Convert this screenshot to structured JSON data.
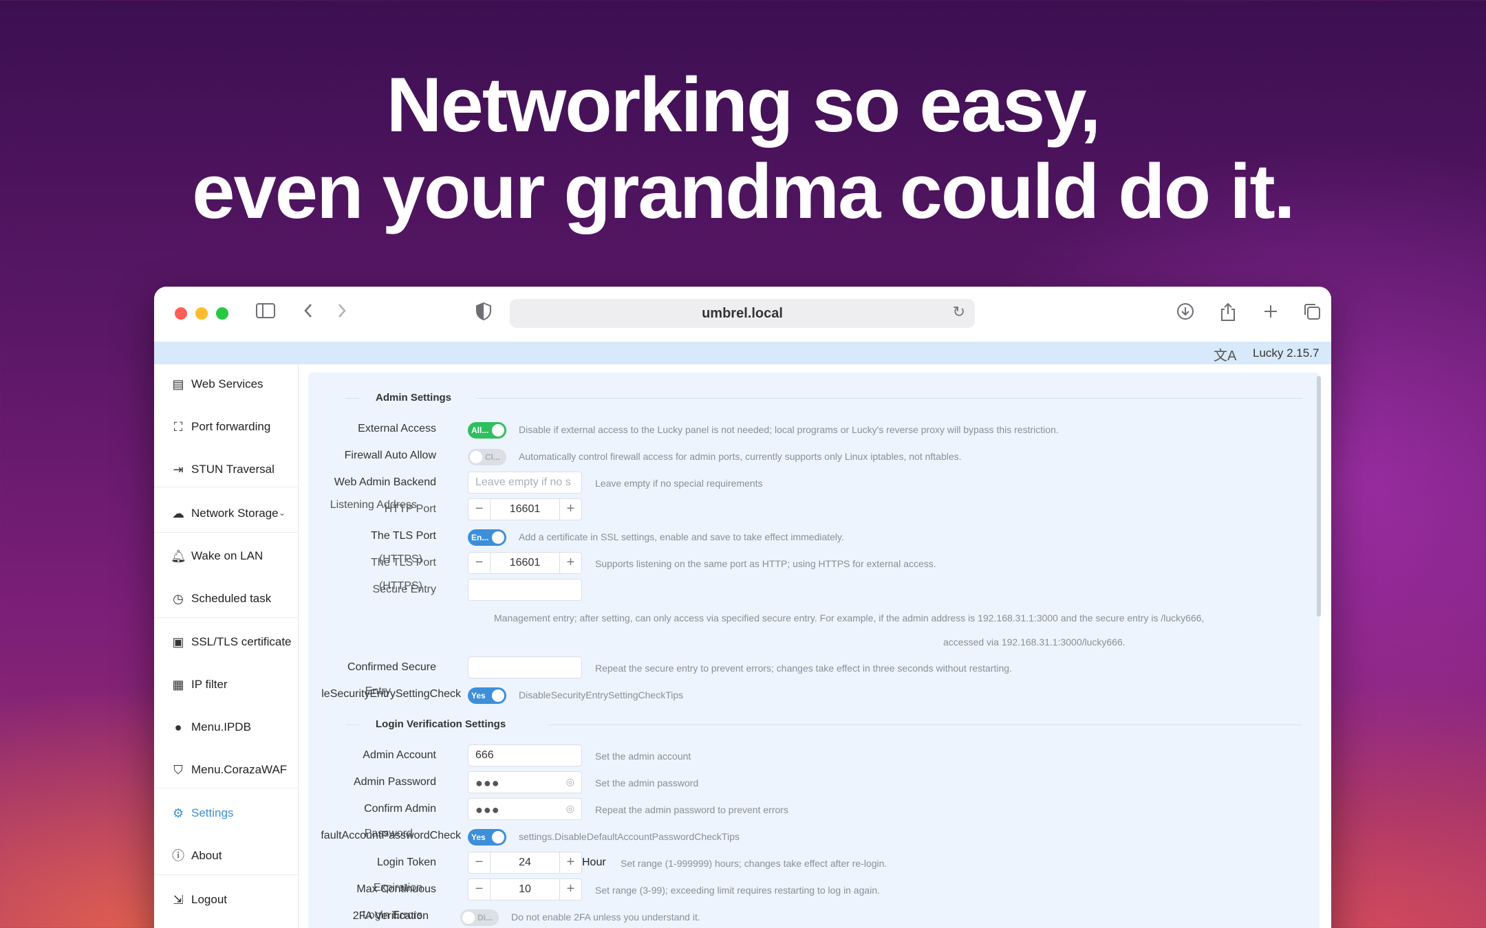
{
  "headline": {
    "line1": "Networking so easy,",
    "line2": "even your grandma could do it."
  },
  "browser": {
    "url": "umbrel.local"
  },
  "appbar": {
    "version": "Lucky 2.15.7"
  },
  "sidebar": {
    "items": [
      {
        "label": "Web Services"
      },
      {
        "label": "Port forwarding"
      },
      {
        "label": "STUN Traversal"
      },
      {
        "label": "Network Storage"
      },
      {
        "label": "Wake on LAN"
      },
      {
        "label": "Scheduled task"
      },
      {
        "label": "SSL/TLS certificate"
      },
      {
        "label": "IP filter"
      },
      {
        "label": "Menu.IPDB"
      },
      {
        "label": "Menu.CorazaWAF"
      },
      {
        "label": "Settings"
      },
      {
        "label": "About"
      },
      {
        "label": "Logout"
      }
    ]
  },
  "admin": {
    "section_title": "Admin Settings",
    "external_access": {
      "label": "External Access",
      "toggle": "All...",
      "tip": "Disable if external access to the Lucky panel is not needed; local programs or Lucky's reverse proxy will bypass this restriction."
    },
    "firewall": {
      "label": "Firewall Auto Allow",
      "toggle": "Cl...",
      "tip": "Automatically control firewall access for admin ports, currently supports only Linux iptables, not nftables."
    },
    "backend": {
      "label": "Web Admin Backend",
      "placeholder": "Leave empty if no s",
      "tip": "Leave empty if no special requirements"
    },
    "listening": {
      "label": "Listening Address",
      "label2": "HTTP Port",
      "value": "16601"
    },
    "tls": {
      "label": "The TLS Port",
      "toggle": "En...",
      "tip": "Add a certificate in SSL settings, enable and save to take effect immediately."
    },
    "tls_port": {
      "label": "The TLS Port",
      "label2": "(HTTPS)",
      "value": "16601",
      "tip": "Supports listening on the same port as HTTP; using HTTPS for external access."
    },
    "secure_entry": {
      "label": "(HTTPS)",
      "label2": "Secure Entry",
      "tip_line1": "Management entry; after setting, can only access via specified secure entry. For example, if the admin address is 192.168.31.1:3000 and the secure entry is /lucky666,",
      "tip_line2": "accessed via 192.168.31.1:3000/lucky666."
    },
    "confirm_secure": {
      "label": "Confirmed Secure",
      "label2": "Entry",
      "tip": "Repeat the secure entry to prevent errors; changes take effect in three seconds without restarting."
    },
    "disable_check": {
      "label": "leSecurityEntrySettingCheck",
      "toggle": "Yes",
      "tip": "DisableSecurityEntrySettingCheckTips"
    }
  },
  "login": {
    "section_title": "Login Verification Settings",
    "account": {
      "label": "Admin Account",
      "value": "666",
      "tip": "Set the admin account"
    },
    "password": {
      "label": "Admin Password",
      "value": "●●●",
      "tip": "Set the admin password"
    },
    "confirm": {
      "label": "Confirm Admin",
      "label2": "Password",
      "value": "●●●",
      "tip": "Repeat the admin password to prevent errors"
    },
    "default_check": {
      "label": "faultAccountPasswordCheck",
      "toggle": "Yes",
      "tip": "settings.DisableDefaultAccountPasswordCheckTips"
    },
    "token": {
      "label": "Login Token",
      "label2": "Expiration",
      "value": "24",
      "unit": "Hour",
      "tip": "Set range (1-999999) hours; changes take effect after re-login."
    },
    "max_errors": {
      "label": "Max Continuous",
      "label2": "Login Errors",
      "value": "10",
      "tip": "Set range (3-99); exceeding limit requires restarting to log in again."
    },
    "twofa": {
      "label": "2FA Verification",
      "toggle": "Di...",
      "tip": "Do not enable 2FA unless you understand it."
    }
  },
  "colors": {
    "accent": "#3d8fd9",
    "green": "#2fbf5f",
    "appbar": "#d7e9fa",
    "content_bg": "#edf4fd"
  },
  "icons": [
    "sidebar-toggle-icon",
    "back-icon",
    "forward-icon",
    "shield-icon",
    "reload-icon",
    "download-icon",
    "share-icon",
    "new-tab-icon",
    "tabs-icon",
    "translate-icon"
  ]
}
